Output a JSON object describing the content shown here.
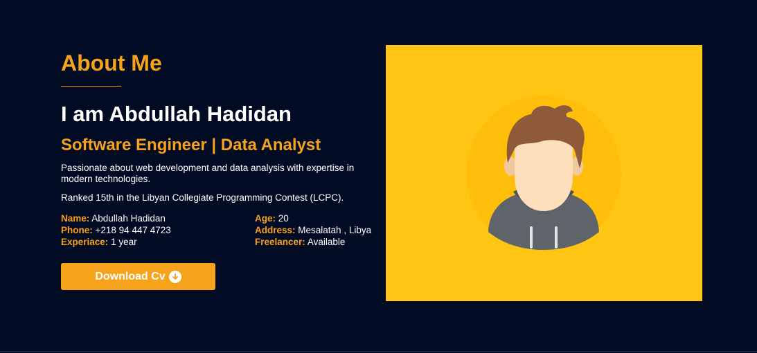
{
  "about": {
    "title": "About Me",
    "heading": "I am Abdullah Hadidan",
    "role": "Software Engineer | Data Analyst",
    "description": "Passionate about web development and data analysis with expertise in modern technologies.",
    "achievement": "Ranked 15th in the Libyan Collegiate Programming Contest (LCPC).",
    "info": {
      "name_label": "Name:",
      "name_value": "Abdullah Hadidan",
      "age_label": "Age:",
      "age_value": "20",
      "phone_label": "Phone:",
      "phone_value": "+218 94 447 4723",
      "address_label": "Address:",
      "address_value": "Mesalatah , Libya",
      "experience_label": "Experiace:",
      "experience_value": "1 year",
      "freelancer_label": "Freelancer:",
      "freelancer_value": "Available"
    },
    "download_label": "Download Cv",
    "download_icon": "arrow-down-circle-icon"
  },
  "colors": {
    "background": "#020b24",
    "accent": "#f7a21b",
    "photo_background": "#ffc514"
  }
}
